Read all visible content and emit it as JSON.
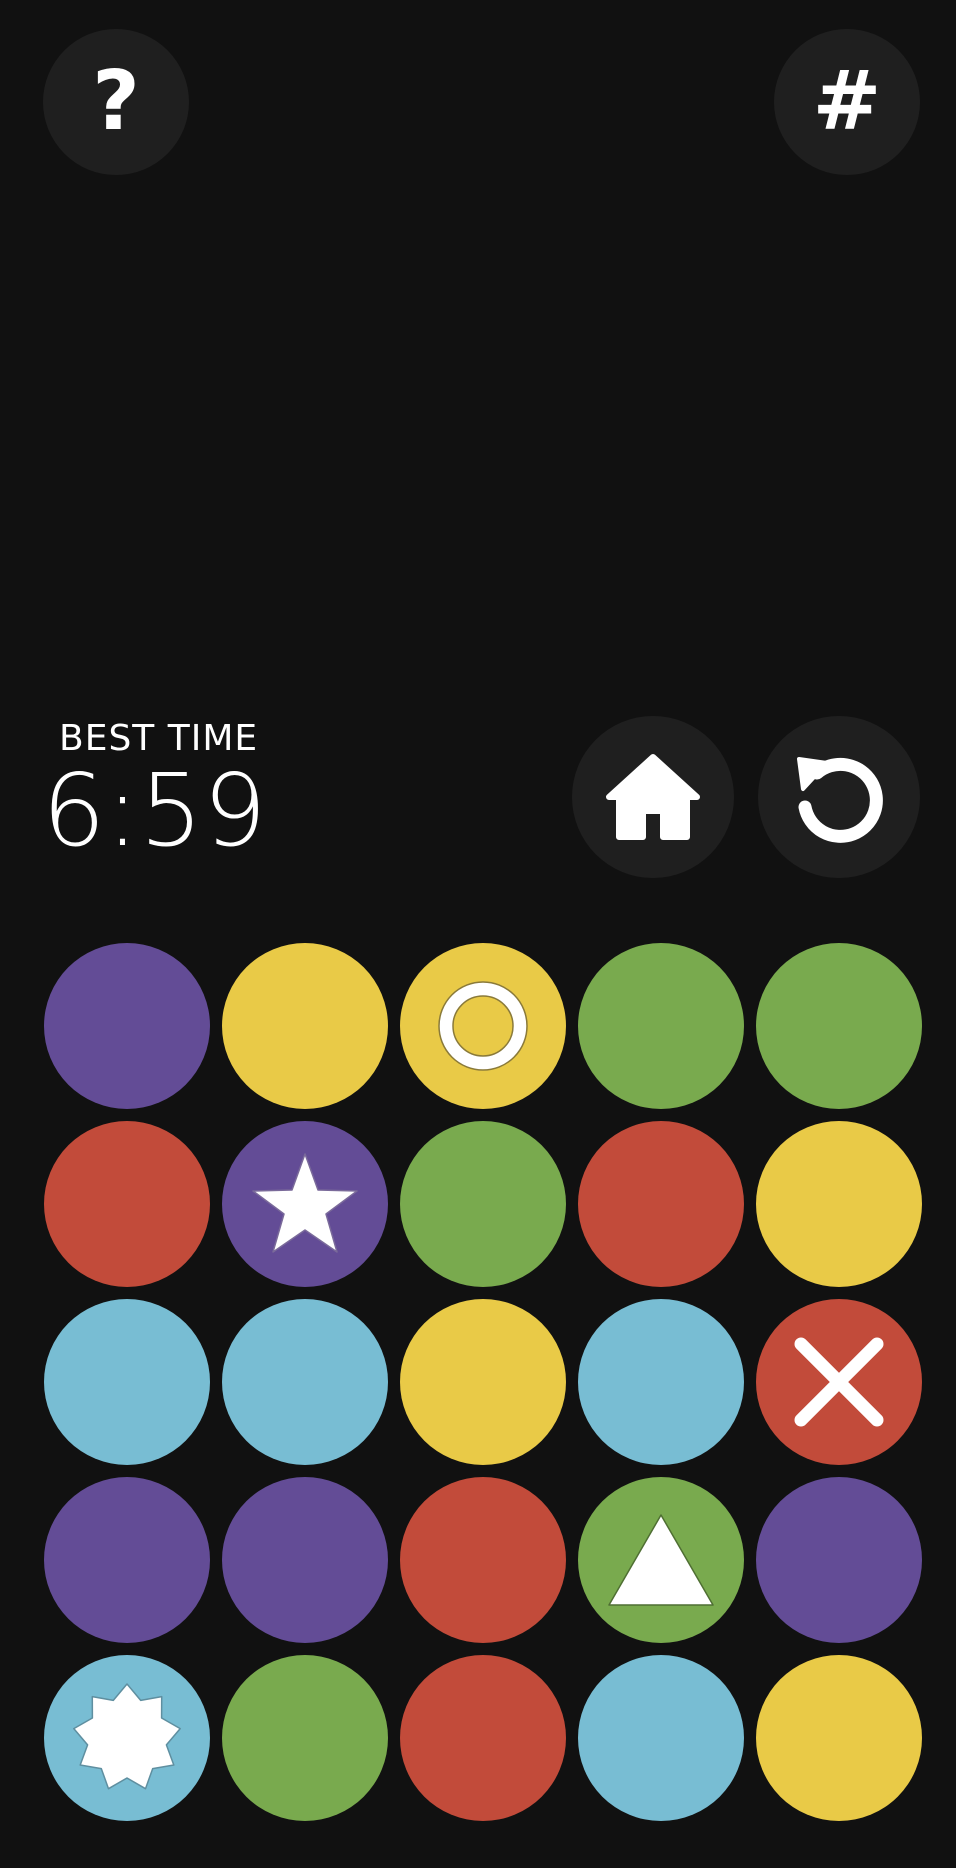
{
  "header": {
    "help_icon": "question-mark-icon",
    "help_glyph": "?",
    "grid_icon": "hash-icon",
    "grid_glyph": "#"
  },
  "stats": {
    "best_label": "BEST TIME",
    "best_value": "6:59"
  },
  "controls": {
    "home_icon": "home-icon",
    "restart_icon": "restart-icon"
  },
  "colors": {
    "purple": "#634c96",
    "yellow": "#e9ca47",
    "green": "#79aa4e",
    "red": "#c24b3a",
    "blue": "#78bdd3",
    "button_bg": "#1f1f1f",
    "background": "#111111"
  },
  "board": {
    "columns": 5,
    "rows": [
      [
        {
          "color": "purple",
          "symbol": ""
        },
        {
          "color": "yellow",
          "symbol": ""
        },
        {
          "color": "yellow",
          "symbol": "ring"
        },
        {
          "color": "green",
          "symbol": ""
        },
        {
          "color": "green",
          "symbol": ""
        }
      ],
      [
        {
          "color": "red",
          "symbol": ""
        },
        {
          "color": "purple",
          "symbol": "star"
        },
        {
          "color": "green",
          "symbol": ""
        },
        {
          "color": "red",
          "symbol": ""
        },
        {
          "color": "yellow",
          "symbol": ""
        }
      ],
      [
        {
          "color": "blue",
          "symbol": ""
        },
        {
          "color": "blue",
          "symbol": ""
        },
        {
          "color": "yellow",
          "symbol": ""
        },
        {
          "color": "blue",
          "symbol": ""
        },
        {
          "color": "red",
          "symbol": "cross"
        }
      ],
      [
        {
          "color": "purple",
          "symbol": ""
        },
        {
          "color": "purple",
          "symbol": ""
        },
        {
          "color": "red",
          "symbol": ""
        },
        {
          "color": "green",
          "symbol": "triangle"
        },
        {
          "color": "purple",
          "symbol": ""
        }
      ],
      [
        {
          "color": "blue",
          "symbol": "burst"
        },
        {
          "color": "green",
          "symbol": ""
        },
        {
          "color": "red",
          "symbol": ""
        },
        {
          "color": "blue",
          "symbol": ""
        },
        {
          "color": "yellow",
          "symbol": ""
        }
      ]
    ]
  }
}
